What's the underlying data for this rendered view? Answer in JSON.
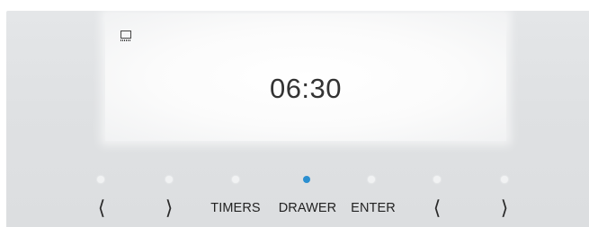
{
  "display": {
    "time": "06:30",
    "status_icon": "oven-display-icon"
  },
  "controls": {
    "left_prev": "⟨",
    "left_next": "⟩",
    "timers": "TIMERS",
    "drawer": "DRAWER",
    "enter": "ENTER",
    "right_prev": "⟨",
    "right_next": "⟩",
    "active_indicator": "drawer"
  },
  "colors": {
    "indicator_active": "#2b8fd0",
    "indicator_inactive": "#f1f2f3",
    "panel": "#dfe1e3",
    "text": "#222222"
  }
}
